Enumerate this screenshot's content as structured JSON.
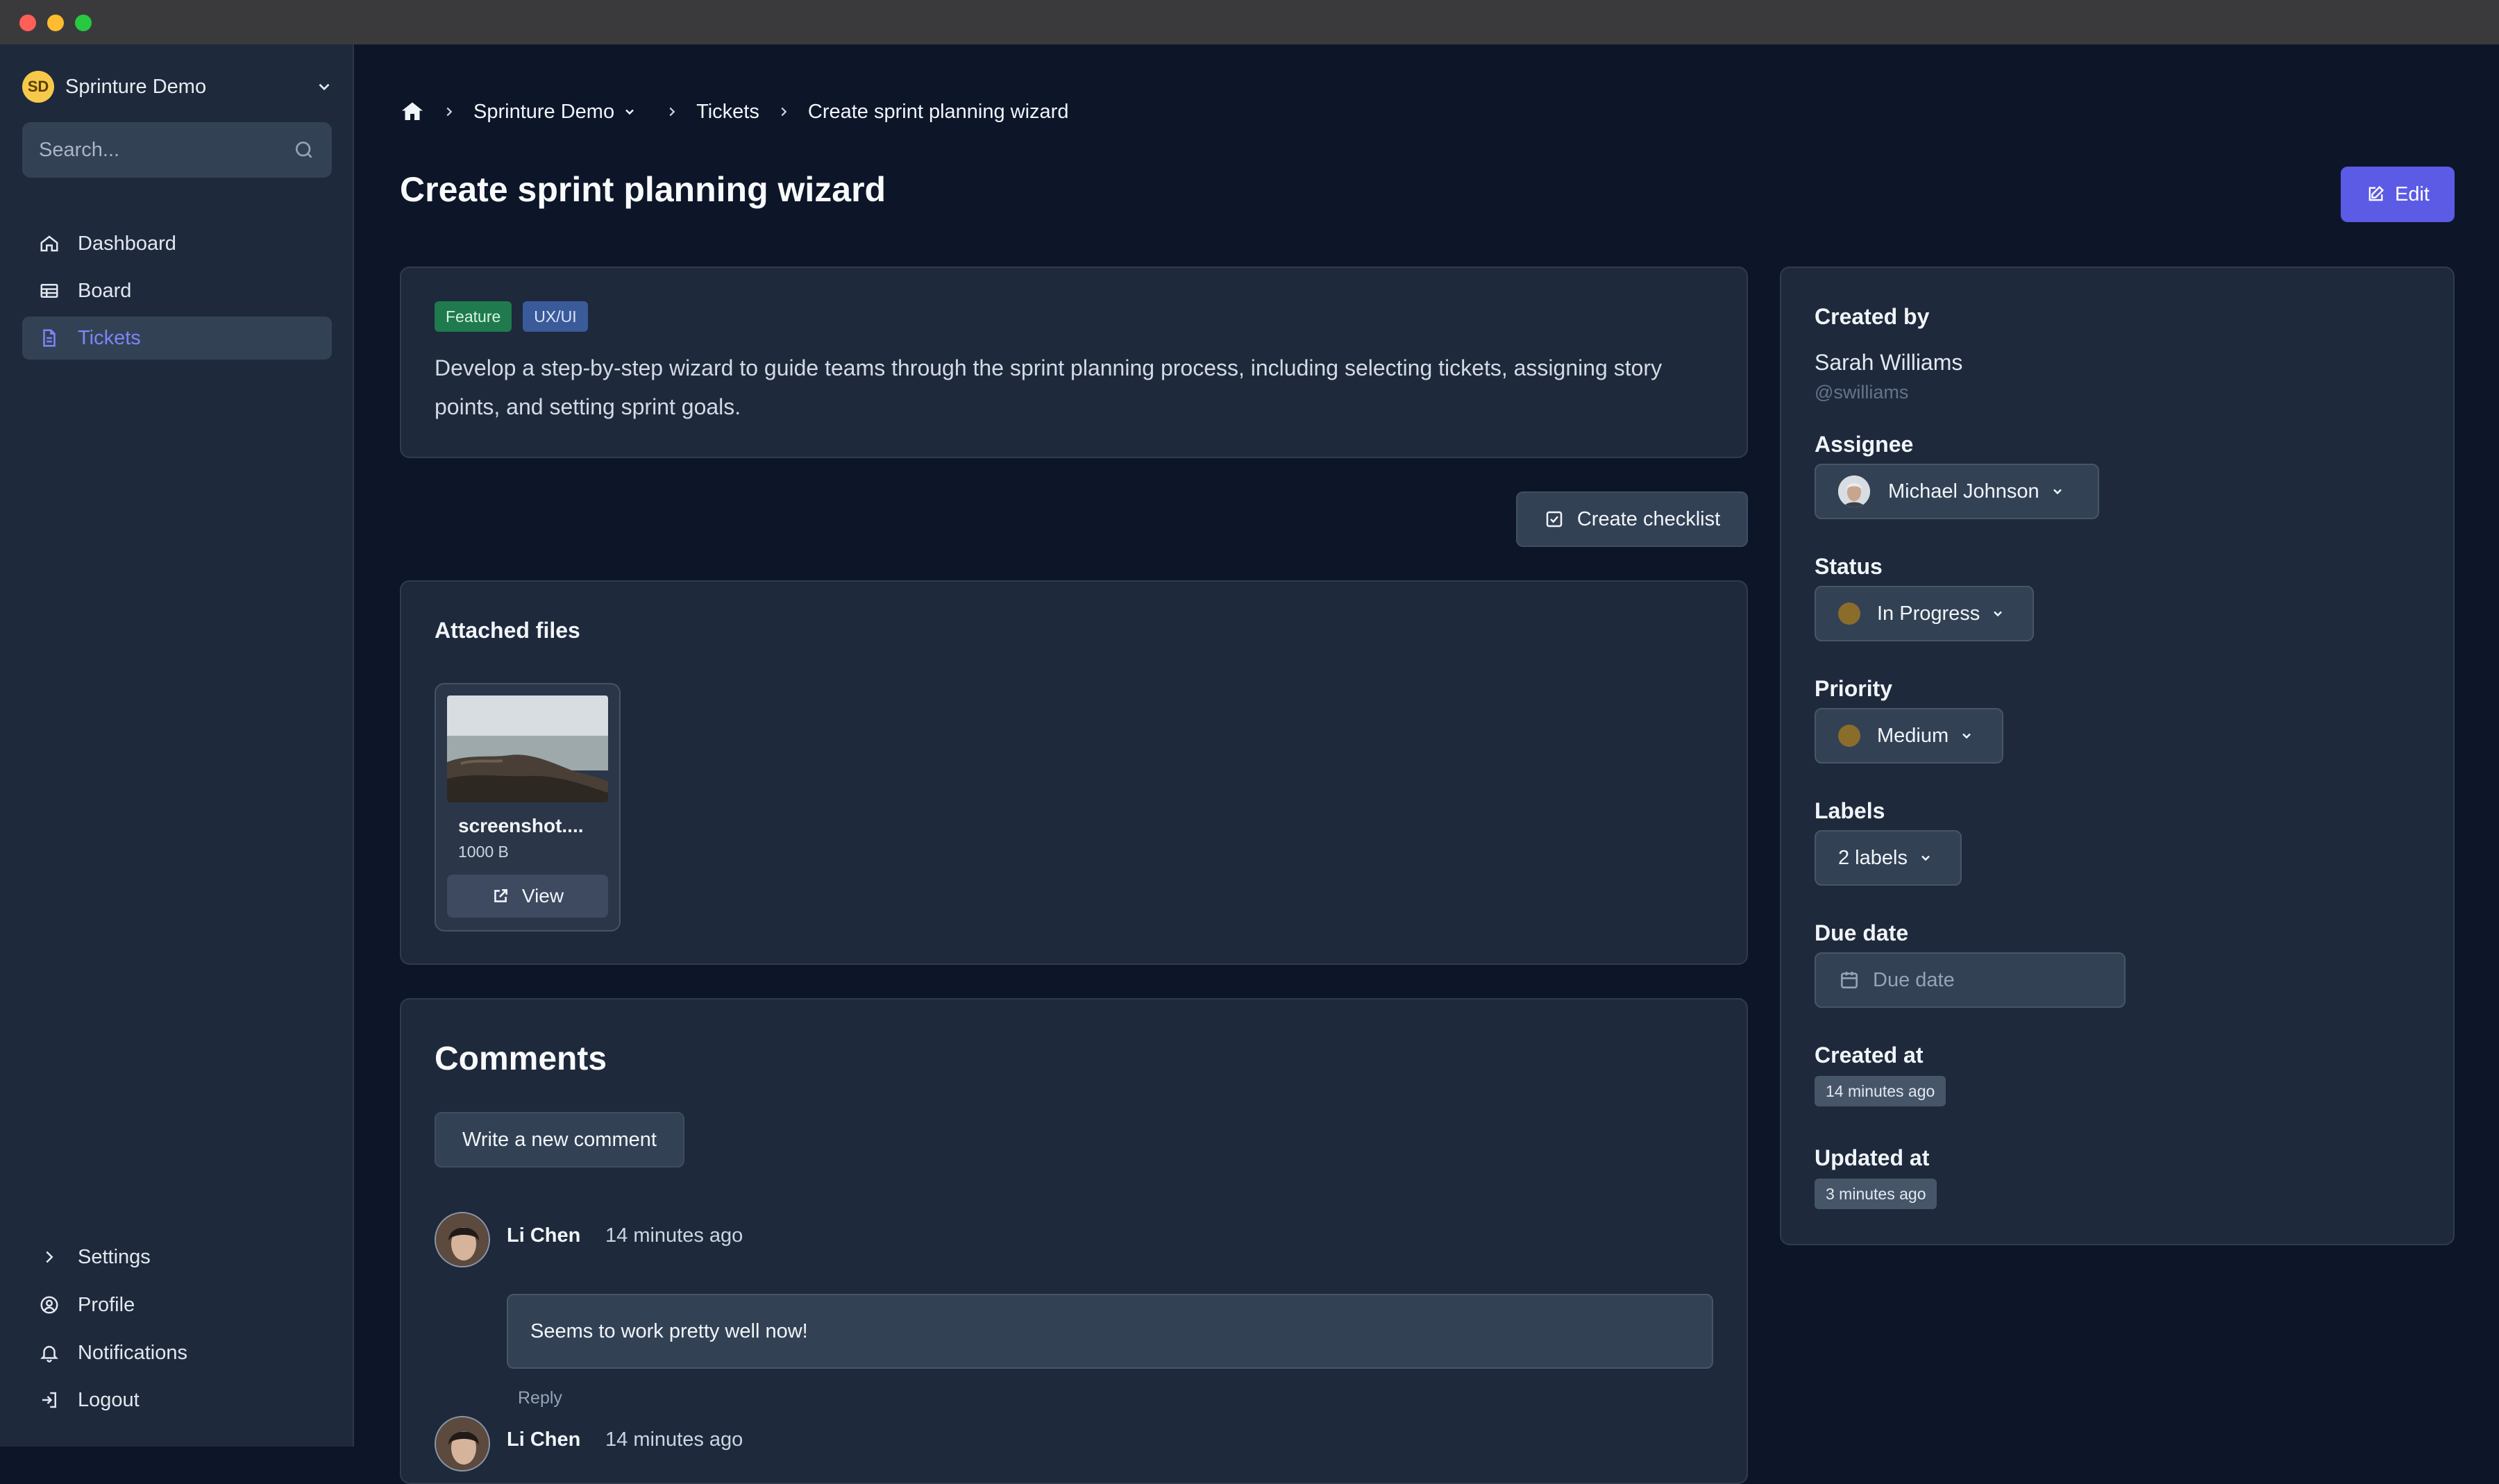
{
  "window": {
    "traffic_lights": [
      "close",
      "minimize",
      "zoom"
    ]
  },
  "sidebar": {
    "workspace": {
      "initials": "SD",
      "name": "Sprinture Demo"
    },
    "search": {
      "placeholder": "Search..."
    },
    "nav": [
      {
        "label": "Dashboard",
        "icon": "home-icon"
      },
      {
        "label": "Board",
        "icon": "table-icon"
      },
      {
        "label": "Tickets",
        "icon": "document-icon",
        "active": true
      }
    ],
    "bottom": [
      {
        "label": "Settings",
        "icon": "chevron-right-icon"
      },
      {
        "label": "Profile",
        "icon": "user-circle-icon"
      },
      {
        "label": "Notifications",
        "icon": "bell-icon"
      },
      {
        "label": "Logout",
        "icon": "logout-icon"
      }
    ]
  },
  "breadcrumb": {
    "project": "Sprinture Demo",
    "section": "Tickets",
    "current": "Create sprint planning wizard"
  },
  "ticket": {
    "title": "Create sprint planning wizard",
    "edit_label": "Edit",
    "tags": [
      "Feature",
      "UX/UI"
    ],
    "description": "Develop a step-by-step wizard to guide teams through the sprint planning process, including selecting tickets, assigning story points, and setting sprint goals.",
    "create_checklist_label": "Create checklist"
  },
  "attachments": {
    "heading": "Attached files",
    "files": [
      {
        "name": "screenshot....",
        "size": "1000 B",
        "view_label": "View"
      }
    ]
  },
  "comments": {
    "heading": "Comments",
    "write_label": "Write a new comment",
    "items": [
      {
        "author": "Li Chen",
        "time": "14 minutes ago",
        "text": "Seems to work pretty well now!",
        "reply_label": "Reply"
      },
      {
        "author": "Li Chen",
        "time": "14 minutes ago"
      }
    ]
  },
  "details": {
    "created_by_label": "Created by",
    "creator_name": "Sarah Williams",
    "creator_handle": "@swilliams",
    "assignee_label": "Assignee",
    "assignee": "Michael Johnson",
    "status_label": "Status",
    "status": "In Progress",
    "priority_label": "Priority",
    "priority": "Medium",
    "labels_label": "Labels",
    "labels_value": "2 labels",
    "due_date_label": "Due date",
    "due_date_placeholder": "Due date",
    "created_at_label": "Created at",
    "created_at": "14 minutes ago",
    "updated_at_label": "Updated at",
    "updated_at": "3 minutes ago"
  },
  "colors": {
    "accent": "#5b5be6",
    "active_nav": "#7c86f7",
    "tag_feature": "#1f7a4d",
    "tag_ux": "#3a5a9a",
    "status_dot": "#8a6d2b"
  }
}
